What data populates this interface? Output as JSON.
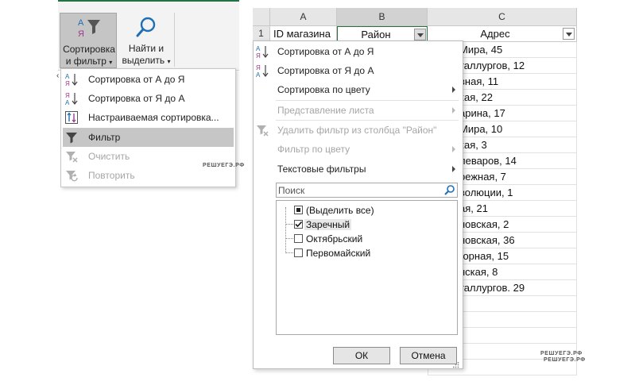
{
  "ribbon": {
    "sort_filter": {
      "line1": "Сортировка",
      "line2": "и фильтр",
      "icon": "sort-filter-icon"
    },
    "find_select": {
      "line1": "Найти и",
      "line2": "выделить",
      "icon": "magnifier-icon"
    }
  },
  "sort_menu": {
    "items": [
      {
        "label": "Сортировка от А до Я",
        "icon": "sort-az-icon",
        "disabled": false,
        "selected": false
      },
      {
        "label": "Сортировка от Я до А",
        "icon": "sort-za-icon",
        "disabled": false,
        "selected": false
      },
      {
        "label": "Настраиваемая сортировка...",
        "icon": "custom-sort-icon",
        "disabled": false,
        "selected": false
      },
      {
        "label": "Фильтр",
        "icon": "funnel-icon",
        "disabled": false,
        "selected": true
      },
      {
        "label": "Очистить",
        "icon": "clear-filter-icon",
        "disabled": true,
        "selected": false
      },
      {
        "label": "Повторить",
        "icon": "reapply-filter-icon",
        "disabled": true,
        "selected": false
      }
    ],
    "watermark": "РЕШУЕГЭ.РФ"
  },
  "sheet": {
    "columns": [
      "A",
      "B",
      "C"
    ],
    "row_number": "1",
    "headers": [
      "ID магазина",
      "Район",
      "Адрес"
    ],
    "addresses": [
      "Мира, 45",
      "таллургов, 12",
      "вная, 11",
      "кая, 22",
      "арина, 17",
      "Мира, 10",
      "кая, 3",
      "леваров, 14",
      "режная, 7",
      "волюции, 1",
      "ая, 21",
      "новская, 2",
      "новская, 36",
      "горная, 15",
      "нская, 8",
      "таллургов. 29"
    ],
    "watermark_1": "РЕШУЕГЭ.РФ",
    "watermark_2": "РЕШУЕГЭ.РФ"
  },
  "filter_dropdown": {
    "menu": [
      {
        "label": "Сортировка от А до Я",
        "icon": "sort-az-icon",
        "disabled": false,
        "submenu": false
      },
      {
        "label": "Сортировка от Я до А",
        "icon": "sort-za-icon",
        "disabled": false,
        "submenu": false
      },
      {
        "label": "Сортировка по цвету",
        "icon": "",
        "disabled": false,
        "submenu": true
      },
      {
        "label": "Представление листа",
        "icon": "",
        "disabled": true,
        "submenu": true
      },
      {
        "label": "Удалить фильтр из столбца \"Район\"",
        "icon": "clear-filter-icon",
        "disabled": true,
        "submenu": false
      },
      {
        "label": "Фильтр по цвету",
        "icon": "",
        "disabled": true,
        "submenu": true
      },
      {
        "label": "Текстовые фильтры",
        "icon": "",
        "disabled": false,
        "submenu": true
      }
    ],
    "search": {
      "placeholder": "Поиск",
      "value": ""
    },
    "values": [
      {
        "label": "(Выделить все)",
        "state": "partial"
      },
      {
        "label": "Заречный",
        "state": "checked"
      },
      {
        "label": "Октябрьский",
        "state": "unchecked"
      },
      {
        "label": "Первомайский",
        "state": "unchecked"
      }
    ],
    "ok_label": "ОК",
    "cancel_label": "Отмена"
  }
}
